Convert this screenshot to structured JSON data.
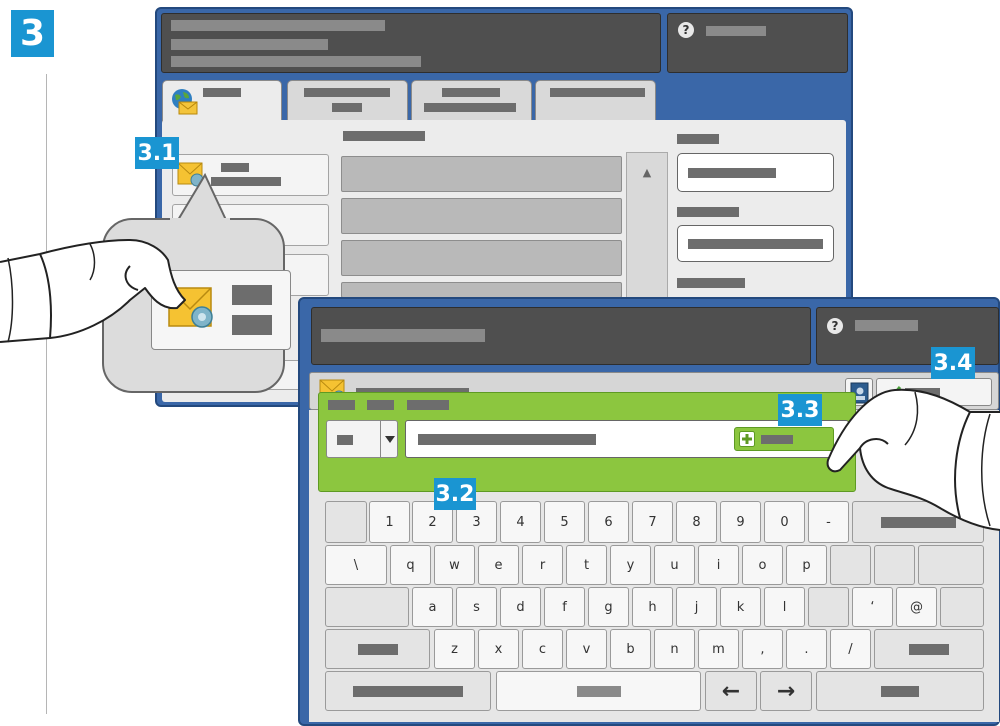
{
  "step": "3",
  "callouts": {
    "c31": "3.1",
    "c32": "3.2",
    "c33": "3.3",
    "c34": "3.4"
  },
  "keyboard": {
    "row1": [
      "1",
      "2",
      "3",
      "4",
      "5",
      "6",
      "7",
      "8",
      "9",
      "0",
      "-"
    ],
    "row2": [
      "\\",
      "q",
      "w",
      "e",
      "r",
      "t",
      "y",
      "u",
      "i",
      "o",
      "p"
    ],
    "row3": [
      "a",
      "s",
      "d",
      "f",
      "g",
      "h",
      "j",
      "k",
      "l",
      "‘",
      "@"
    ],
    "row4": [
      "z",
      "x",
      "c",
      "v",
      "b",
      "n",
      "m",
      ",",
      ".",
      "/"
    ],
    "arrow_left": "←",
    "arrow_right": "→"
  },
  "scroll_up_glyph": "▲",
  "help_glyph": "?",
  "icons": {
    "email_globe": "email-globe-icon",
    "email_settings": "email-settings-icon",
    "address_book": "address-book-icon",
    "check": "check-icon",
    "add": "plus-icon",
    "dropdown": "chevron-down-icon"
  },
  "colors": {
    "frame_blue": "#3a67a8",
    "callout_blue": "#1a95d2",
    "entry_green": "#8cc63f",
    "header_gray": "#4f4f4f"
  }
}
